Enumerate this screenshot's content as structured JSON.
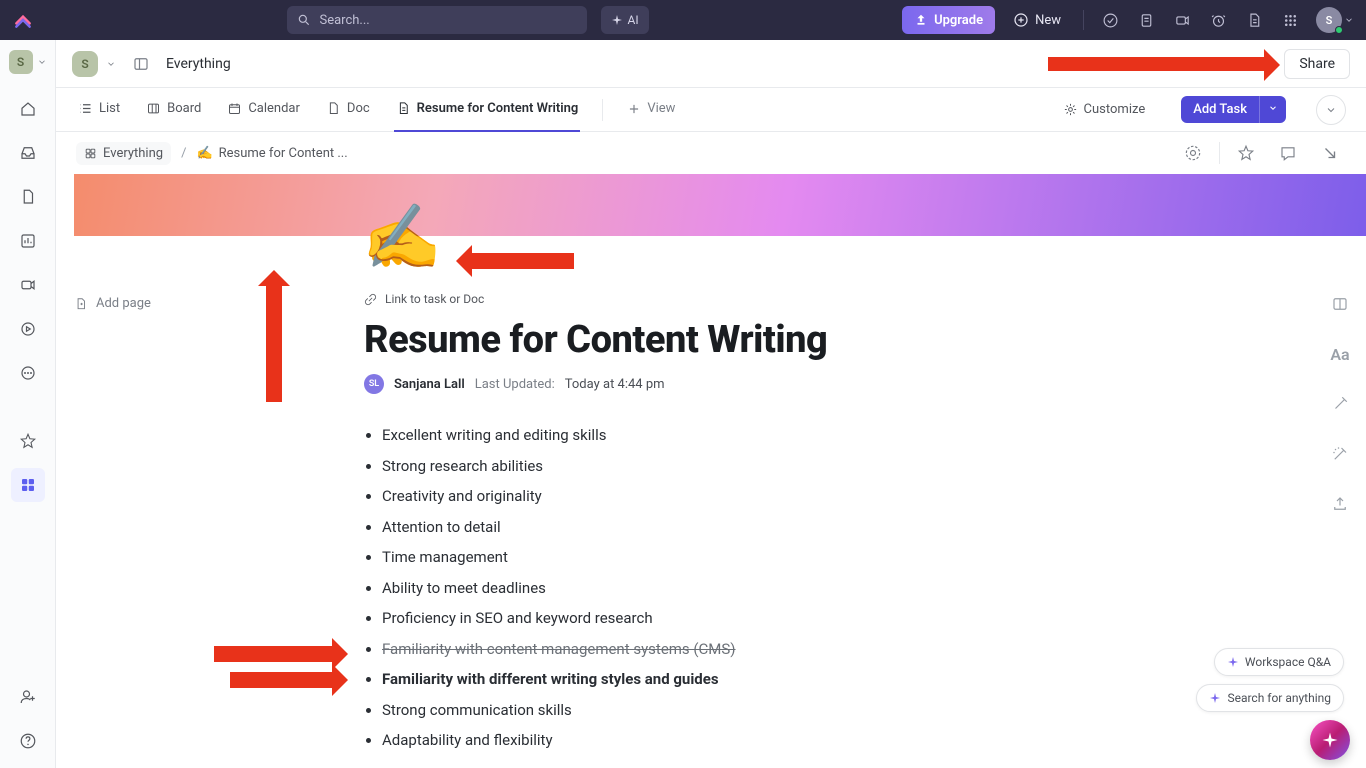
{
  "topbar": {
    "search_placeholder": "Search...",
    "ai_label": "AI",
    "upgrade_label": "Upgrade",
    "new_label": "New",
    "avatar_initial": "S"
  },
  "header": {
    "workspace_initial": "S",
    "title": "Everything",
    "share_label": "Share"
  },
  "tabs": [
    {
      "label": "List",
      "icon": "list"
    },
    {
      "label": "Board",
      "icon": "board"
    },
    {
      "label": "Calendar",
      "icon": "calendar"
    },
    {
      "label": "Doc",
      "icon": "doc"
    },
    {
      "label": "Resume for Content Writing",
      "icon": "doc",
      "active": true
    }
  ],
  "add_view_label": "View",
  "customize_label": "Customize",
  "add_task_label": "Add Task",
  "breadcrumb": {
    "root": "Everything",
    "doc_emoji": "✍️",
    "doc_label": "Resume for Content ..."
  },
  "leftpanel": {
    "add_page_label": "Add page"
  },
  "doc": {
    "emoji": "✍️",
    "link_task_label": "Link to task or Doc",
    "title": "Resume for Content Writing",
    "author_initials": "SL",
    "author_name": "Sanjana Lall",
    "last_updated_label": "Last Updated:",
    "last_updated_value": "Today at 4:44 pm",
    "bullets": [
      {
        "text": "Excellent writing and editing skills"
      },
      {
        "text": "Strong research abilities"
      },
      {
        "text": "Creativity and originality"
      },
      {
        "text": "Attention to detail"
      },
      {
        "text": "Time management"
      },
      {
        "text": "Ability to meet deadlines"
      },
      {
        "text": "Proficiency in SEO and keyword research"
      },
      {
        "text": "Familiarity with content management systems (CMS)",
        "strike": true
      },
      {
        "text": "Familiarity with different writing styles and guides",
        "bold": true
      },
      {
        "text": "Strong communication skills"
      },
      {
        "text": "Adaptability and flexibility"
      }
    ]
  },
  "chips": {
    "workspace_qa": "Workspace Q&A",
    "search_anything": "Search for anything"
  },
  "colors": {
    "accent": "#4f48d6",
    "upgrade_gradient_start": "#7b68ee",
    "arrow": "#e8321a"
  }
}
